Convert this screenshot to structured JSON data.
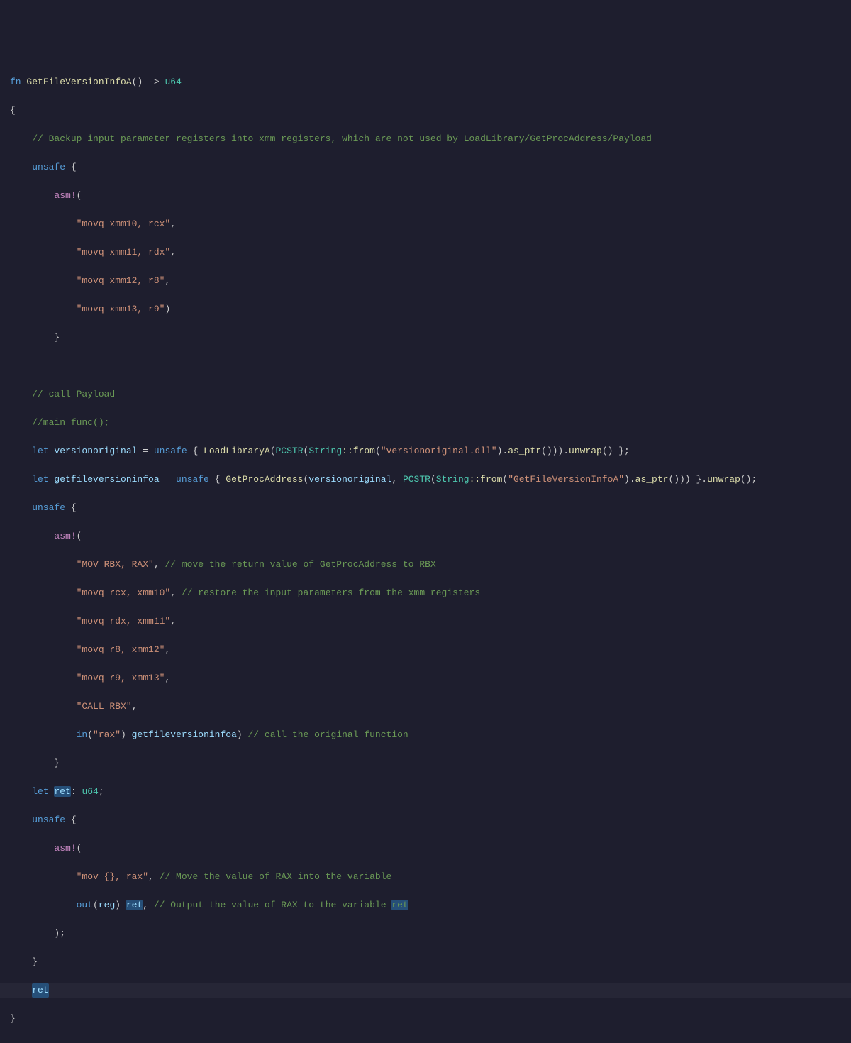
{
  "code": {
    "l1_fn": "fn",
    "l1_name": "GetFileVersionInfoA",
    "l1_paren": "()",
    "l1_arrow": " -> ",
    "l1_ret": "u64",
    "l2": "{",
    "l3_cmt": "    // Backup input parameter registers into xmm registers, which are not used by LoadLibrary/GetProcAddress/Payload",
    "l4_unsafe": "    unsafe",
    "l4_brace": " {",
    "l5_asm": "        asm!",
    "l5_p": "(",
    "l6": "            \"movq xmm10, rcx\"",
    "l7": "            \"movq xmm11, rdx\"",
    "l8": "            \"movq xmm12, r8\"",
    "l9": "            \"movq xmm13, r9\"",
    "l10": "        }",
    "l12_cmt": "    // call Payload",
    "l13_cmt": "    //main_func();",
    "l14_let": "    let",
    "l14_var": " versionoriginal",
    "l14_eq": " = ",
    "l14_unsafe": "unsafe",
    "l14_ob": " { ",
    "l14_load": "LoadLibraryA",
    "l14_op": "(",
    "l14_pcstr": "PCSTR",
    "l14_op2": "(",
    "l14_string": "String",
    "l14_from": "::from",
    "l14_op3": "(",
    "l14_s": "\"versionoriginal.dll\"",
    "l14_cp": ").",
    "l14_asptr": "as_ptr",
    "l14_cp2": "())).",
    "l14_unwrap": "unwrap",
    "l14_end": "() };",
    "l15_let": "    let",
    "l15_var": " getfileversioninfoa",
    "l15_eq": " = ",
    "l15_unsafe": "unsafe",
    "l15_ob": " { ",
    "l15_gpa": "GetProcAddress",
    "l15_op": "(",
    "l15_vo": "versionoriginal",
    "l15_c": ", ",
    "l15_pcstr": "PCSTR",
    "l15_op2": "(",
    "l15_string": "String",
    "l15_from": "::from",
    "l15_op3": "(",
    "l15_s": "\"GetFileVersionInfoA\"",
    "l15_cp": ").",
    "l15_asptr": "as_ptr",
    "l15_cp2": "())) }.",
    "l15_unwrap": "unwrap",
    "l15_end": "();",
    "l16_unsafe": "    unsafe",
    "l16_b": " {",
    "l17_asm": "        asm!",
    "l17_p": "(",
    "l18": "            \"MOV RBX, RAX\"",
    "l18_c": ", ",
    "l18_cmt": "// move the return value of GetProcAddress to RBX",
    "l19": "            \"movq rcx, xmm10\"",
    "l19_c": ", ",
    "l19_cmt": "// restore the input parameters from the xmm registers",
    "l20": "            \"movq rdx, xmm11\"",
    "l20_c": ",",
    "l21": "            \"movq r8, xmm12\"",
    "l21_c": ",",
    "l22": "            \"movq r9, xmm13\"",
    "l22_c": ",",
    "l23": "            \"CALL RBX\"",
    "l23_c": ",",
    "l24_in": "            in",
    "l24_op": "(",
    "l24_rax": "\"rax\"",
    "l24_cp": ") ",
    "l24_var": "getfileversioninfoa",
    "l24_cp2": ") ",
    "l24_cmt": "// call the original function",
    "l25": "        }",
    "l26_let": "    let",
    "l26_ret": " ret",
    "l26_col": ": ",
    "l26_u64": "u64",
    "l26_sc": ";",
    "l27_unsafe": "    unsafe",
    "l27_b": " {",
    "l28_asm": "        asm!",
    "l28_p": "(",
    "l29": "            \"mov {}, rax\"",
    "l29_c": ", ",
    "l29_cmt": "// Move the value of RAX into the variable",
    "l30_out": "            out",
    "l30_op": "(",
    "l30_reg": "reg",
    "l30_cp": ") ",
    "l30_ret": "ret",
    "l30_c": ", ",
    "l30_cmt": "// Output the value of RAX to the variable ",
    "l30_ret2": "ret",
    "l31": "        );",
    "l32": "    }",
    "l33_ret": "    ret",
    "l34": "}"
  }
}
